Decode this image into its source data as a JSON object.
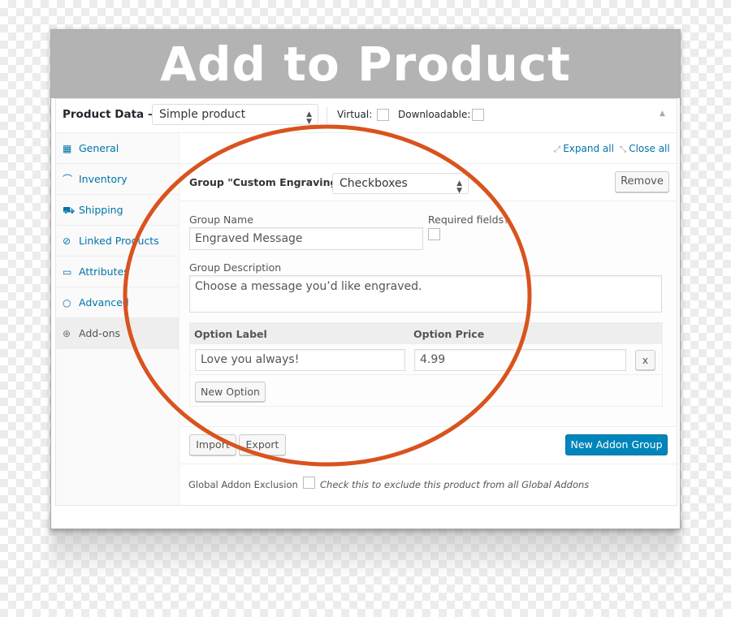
{
  "title": "Add to Product",
  "product_data": {
    "label": "Product Data —",
    "type": "Simple product",
    "virtual_label": "Virtual:",
    "downloadable_label": "Downloadable:",
    "virtual_checked": false,
    "downloadable_checked": false
  },
  "sidebar": {
    "items": [
      {
        "label": "General",
        "icon": "general-icon"
      },
      {
        "label": "Inventory",
        "icon": "inventory-icon"
      },
      {
        "label": "Shipping",
        "icon": "shipping-icon"
      },
      {
        "label": "Linked Products",
        "icon": "link-icon"
      },
      {
        "label": "Attributes",
        "icon": "attributes-icon"
      },
      {
        "label": "Advanced",
        "icon": "gear-icon"
      },
      {
        "label": "Add-ons",
        "icon": "plus-circle-icon",
        "active": true
      }
    ]
  },
  "links": {
    "expand_all": "Expand all",
    "close_all": "Close all"
  },
  "group": {
    "title": "Group \"Custom Engraving\" —",
    "type": "Checkboxes",
    "remove": "Remove",
    "name_label": "Group Name",
    "name_value": "Engraved Message",
    "required_label": "Required fields?",
    "required_checked": false,
    "desc_label": "Group Description",
    "desc_value": "Choose a message you’d like engraved.",
    "option_label_header": "Option Label",
    "option_price_header": "Option Price",
    "options": [
      {
        "label": "Love you always!",
        "price": "4.99",
        "remove": "x"
      }
    ],
    "new_option": "New Option"
  },
  "footer": {
    "import": "Import",
    "export": "Export",
    "new_group": "New Addon Group",
    "exclusion_label": "Global Addon Exclusion",
    "exclusion_text": "Check this to exclude this product from all Global Addons",
    "exclusion_checked": false
  },
  "colors": {
    "accent": "#0073aa",
    "primary_button": "#0085ba",
    "annotation": "#d9531e",
    "header": "#b3b3b3"
  }
}
